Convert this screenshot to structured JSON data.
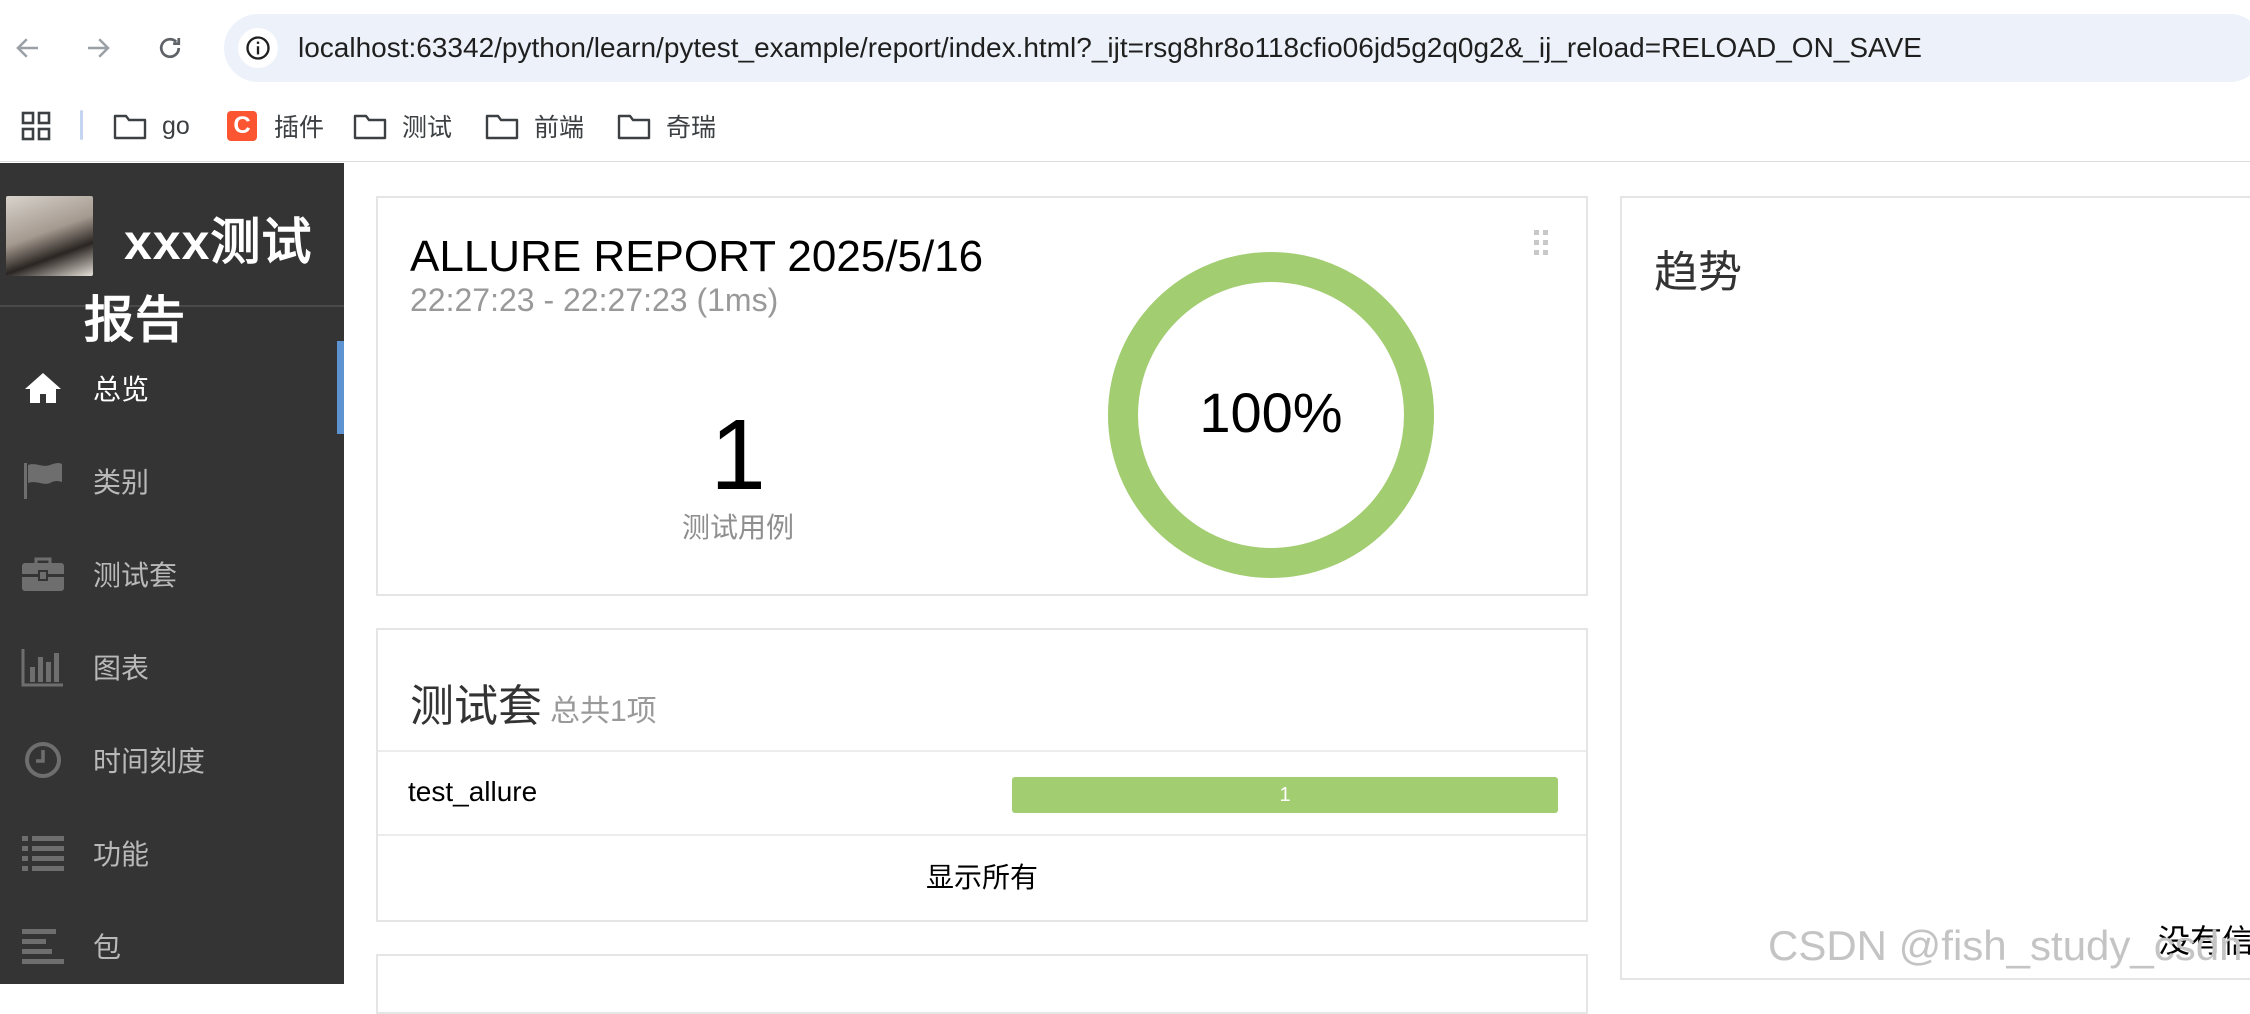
{
  "browser": {
    "url": "localhost:63342/python/learn/pytest_example/report/index.html?_ijt=rsg8hr8o118cfio06jd5g2q0g2&_ij_reload=RELOAD_ON_SAVE",
    "bookmarks": [
      {
        "label": "go",
        "icon": "folder-icon"
      },
      {
        "label": "插件",
        "icon": "csdn-icon",
        "icon_text": "C"
      },
      {
        "label": "测试",
        "icon": "folder-icon"
      },
      {
        "label": "前端",
        "icon": "folder-icon"
      },
      {
        "label": "奇瑞",
        "icon": "folder-icon"
      }
    ]
  },
  "sidebar": {
    "brand": "xxx测试报告",
    "items": [
      {
        "label": "总览",
        "icon": "home-icon",
        "active": true
      },
      {
        "label": "类别",
        "icon": "flag-icon"
      },
      {
        "label": "测试套",
        "icon": "briefcase-icon"
      },
      {
        "label": "图表",
        "icon": "bar-chart-icon"
      },
      {
        "label": "时间刻度",
        "icon": "clock-icon"
      },
      {
        "label": "功能",
        "icon": "list-icon"
      },
      {
        "label": "包",
        "icon": "align-left-icon"
      }
    ]
  },
  "summary": {
    "title": "ALLURE REPORT 2025/5/16",
    "time": "22:27:23 - 22:27:23 (1ms)",
    "count": "1",
    "count_label": "测试用例",
    "percent": "100%",
    "passed_fraction": 1.0,
    "pass_color": "#a3cd71"
  },
  "suites": {
    "title": "测试套",
    "subtitle": "总共1项",
    "rows": [
      {
        "name": "test_allure",
        "count": "1",
        "passed_fraction": 1.0
      }
    ],
    "show_all": "显示所有"
  },
  "trend": {
    "title": "趋势",
    "empty": "没有信"
  },
  "watermark": "CSDN @fish_study_csdn"
}
